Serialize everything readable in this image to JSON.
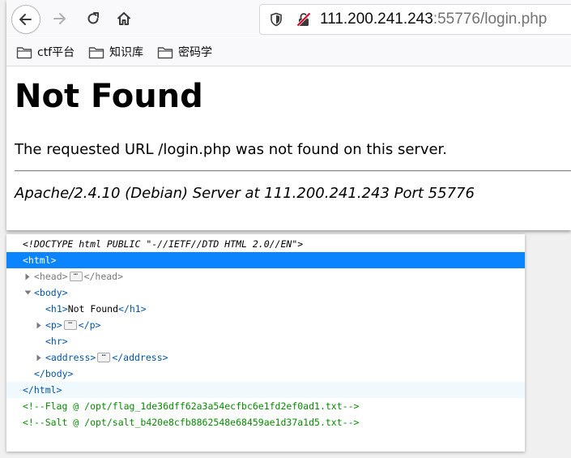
{
  "browser": {
    "url_host": "111.200.241.243",
    "url_rest": ":55776/login.php",
    "bookmarks": [
      {
        "label": "ctf平台",
        "icon": "folder-icon"
      },
      {
        "label": "知识库",
        "icon": "folder-icon"
      },
      {
        "label": "密码学",
        "icon": "folder-icon"
      }
    ]
  },
  "page": {
    "heading": "Not Found",
    "message": "The requested URL /login.php was not found on this server.",
    "address": "Apache/2.4.10 (Debian) Server at 111.200.241.243 Port 55776"
  },
  "inspector": {
    "doctype": "<!DOCTYPE html PUBLIC \"-//IETF//DTD HTML 2.0//EN\">",
    "html_open": "<html>",
    "head_open": "<head>",
    "head_close": "</head>",
    "body_open": "<body>",
    "h1_line_open": "<h1>",
    "h1_text": "Not Found",
    "h1_line_close": "</h1>",
    "p_open": "<p>",
    "p_close": "</p>",
    "hr": "<hr>",
    "address_open": "<address>",
    "address_close": "</address>",
    "body_close": "</body>",
    "html_close": "</html>",
    "comment_flag": "<!--Flag @ /opt/flag_1de36dff62a3a54ecfbc6e1fd2ef0ad1.txt-->",
    "comment_salt": "<!--Salt @ /opt/salt_b420e8cfb8862548e68459ae1d37a1d5.txt-->",
    "ellipsis": "⋯"
  }
}
